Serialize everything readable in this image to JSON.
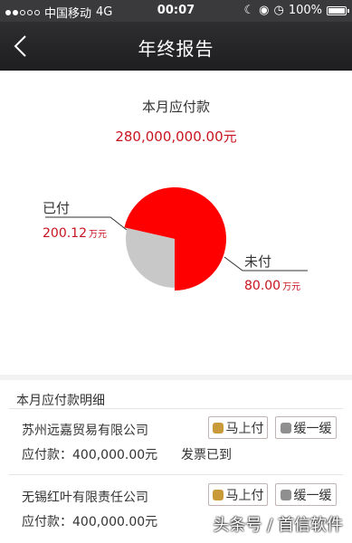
{
  "status_bar": {
    "carrier": "中国移动",
    "network": "4G",
    "time": "00:07",
    "battery": "100%",
    "icons": [
      "moon-icon",
      "lock-rotation-icon",
      "alarm-icon",
      "battery-icon"
    ]
  },
  "nav": {
    "title": "年终报告",
    "back_icon": "chevron-left-icon"
  },
  "summary": {
    "title": "本月应付款",
    "amount": "280,000,000.00元"
  },
  "chart_data": {
    "type": "pie",
    "slices": [
      {
        "name": "已付",
        "value": 200.12,
        "display": "200.12",
        "unit": "万元",
        "color": "#ff0000"
      },
      {
        "name": "未付",
        "value": 80.0,
        "display": "80.00",
        "unit": "万元",
        "color": "#c8c8c8"
      }
    ]
  },
  "details": {
    "heading": "本月应付款明细",
    "items": [
      {
        "company": "苏州远嘉贸易有限公司",
        "payable": "应付款：400,000.00元",
        "status": "发票已到",
        "pay_label": "马上付",
        "delay_label": "缓一缓"
      },
      {
        "company": "无锡红叶有限责任公司",
        "payable": "应付款：400,000.00元",
        "status": "",
        "pay_label": "马上付",
        "delay_label": "缓一缓"
      }
    ]
  },
  "watermark": "头条号 / 首信软件",
  "colors": {
    "accent_red": "#c8141e",
    "nav_bg": "#2a2a2c"
  }
}
